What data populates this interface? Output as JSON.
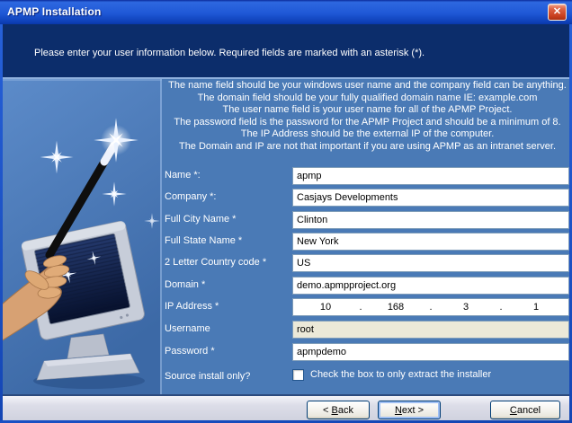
{
  "window": {
    "title": "APMP Installation",
    "close_glyph": "✕"
  },
  "header": {
    "instruction": "Please enter your user information below. Required fields are marked with an asterisk (*)."
  },
  "notes": {
    "lines": [
      "The name field should be your windows user name and the company field can be anything.",
      "The domain field should be your fully qualified domain name IE: example.com",
      "The user name field is your user name for all of the APMP Project.",
      "The password field is the password for the APMP Project and should be a minimum of 8.",
      "The IP Address should be the external IP of the computer.",
      "The Domain and IP are not that important if you are using APMP as an intranet server."
    ]
  },
  "form": {
    "name": {
      "label": "Name *:",
      "value": "apmp"
    },
    "company": {
      "label": "Company *:",
      "value": "Casjays Developments"
    },
    "city": {
      "label": "Full City Name *",
      "value": "Clinton"
    },
    "state": {
      "label": "Full State Name *",
      "value": "New York"
    },
    "country": {
      "label": "2 Letter Country code *",
      "value": "US"
    },
    "domain": {
      "label": "Domain *",
      "value": "demo.apmpproject.org"
    },
    "ip": {
      "label": "IP Address *",
      "octet1": "10",
      "octet2": "168",
      "octet3": "3",
      "octet4": "1",
      "dot": "."
    },
    "username": {
      "label": "Username",
      "value": "root",
      "readonly": true
    },
    "password": {
      "label": "Password *",
      "value": "apmpdemo"
    },
    "source": {
      "label": "Source install only?",
      "checkbox_label": "Check the box to only extract the installer",
      "checked": false
    }
  },
  "buttons": {
    "back": {
      "pre": "< ",
      "key": "B",
      "post": "ack"
    },
    "next": {
      "pre": "",
      "key": "N",
      "post": "ext >"
    },
    "cancel": {
      "pre": "",
      "key": "C",
      "post": "ancel"
    }
  },
  "colors": {
    "titlebar_blue": "#1f58d6",
    "header_navy": "#0c2d6b",
    "main_blue": "#4a7ab6",
    "readonly_beige": "#ece9d8",
    "close_red": "#c8401f",
    "strip_gray": "#d6d8e3"
  }
}
